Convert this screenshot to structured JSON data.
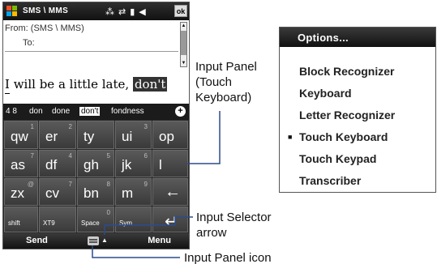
{
  "phone": {
    "title": "SMS \\ MMS",
    "ok_label": "ok",
    "status_icons": [
      "notification-icon",
      "connectivity-icon",
      "signal-icon",
      "volume-icon"
    ],
    "compose": {
      "from_label": "From: (SMS \\ MMS)",
      "to_label": "To:",
      "message_plain": "I will be a little late, ",
      "message_selected": "don't"
    },
    "word_suggestions": {
      "items": [
        "4 8",
        "don",
        "done",
        "don't",
        "fondness"
      ],
      "selected_index": 3,
      "more_label": "+"
    },
    "keyboard": {
      "rows": [
        [
          {
            "main": "qw",
            "sub": "1"
          },
          {
            "main": "er",
            "sub": "2"
          },
          {
            "main": "ty",
            "sub": ""
          },
          {
            "main": "ui",
            "sub": "3"
          },
          {
            "main": "op",
            "sub": ""
          }
        ],
        [
          {
            "main": "as",
            "sub": "7"
          },
          {
            "main": "df",
            "sub": "4"
          },
          {
            "main": "gh",
            "sub": "5"
          },
          {
            "main": "jk",
            "sub": "6"
          },
          {
            "main": "l",
            "sub": ""
          }
        ],
        [
          {
            "main": "zx",
            "sub": "@"
          },
          {
            "main": "cv",
            "sub": "7"
          },
          {
            "main": "bn",
            "sub": "8"
          },
          {
            "main": "m",
            "sub": "9"
          }
        ],
        [
          {
            "main": "shift",
            "sub": ""
          },
          {
            "main": "XT9",
            "sub": ""
          },
          {
            "main": "Space",
            "sub": "0"
          },
          {
            "main": "Sym",
            "sub": ""
          }
        ]
      ],
      "backspace_glyph": "←",
      "enter_glyph": "↵"
    },
    "softkeys": {
      "left": "Send",
      "right": "Menu",
      "selector_glyph": "▲"
    }
  },
  "callouts": {
    "input_panel": [
      "Input Panel",
      "(Touch",
      "Keyboard)"
    ],
    "input_selector": [
      "Input Selector",
      "arrow"
    ],
    "input_panel_icon": "Input Panel icon"
  },
  "options_menu": {
    "header": "Options...",
    "items": [
      "Block Recognizer",
      "Keyboard",
      "Letter Recognizer",
      "Touch Keyboard",
      "Touch Keypad",
      "Transcriber"
    ],
    "active_index": 3,
    "bullet_glyph": "■"
  },
  "colors": {
    "title_bar": "#111111",
    "keyboard_bg": "#2a2a2a",
    "key_face": "#4a4a4a",
    "callout_line": "#2b4b8c",
    "windows_logo": [
      "#f25022",
      "#7fba00",
      "#00a4ef",
      "#ffb900"
    ]
  }
}
